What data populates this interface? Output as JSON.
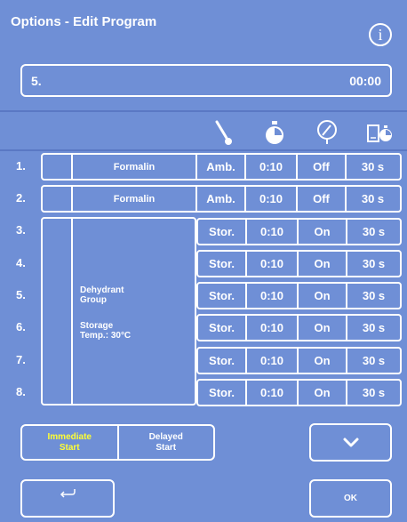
{
  "header": {
    "title": "Options - Edit Program",
    "info_icon": "info-icon"
  },
  "program": {
    "name": "5.",
    "time": "00:00"
  },
  "columns": [
    {
      "name": "temperature",
      "icon": "thermometer-icon"
    },
    {
      "name": "time",
      "icon": "stopwatch-icon"
    },
    {
      "name": "pressure-vacuum",
      "icon": "gauge-icon"
    },
    {
      "name": "drip",
      "icon": "drip-timer-icon"
    }
  ],
  "rows": [
    {
      "num": "1.",
      "reagent": "Formalin",
      "temp": "Amb.",
      "time": "0:10",
      "pv": "Off",
      "drip": "30 s"
    },
    {
      "num": "2.",
      "reagent": "Formalin",
      "temp": "Amb.",
      "time": "0:10",
      "pv": "Off",
      "drip": "30 s"
    },
    {
      "num": "3.",
      "temp": "Stor.",
      "time": "0:10",
      "pv": "On",
      "drip": "30 s"
    },
    {
      "num": "4.",
      "temp": "Stor.",
      "time": "0:10",
      "pv": "On",
      "drip": "30 s"
    },
    {
      "num": "5.",
      "temp": "Stor.",
      "time": "0:10",
      "pv": "On",
      "drip": "30 s"
    },
    {
      "num": "6.",
      "temp": "Stor.",
      "time": "0:10",
      "pv": "On",
      "drip": "30 s"
    },
    {
      "num": "7.",
      "temp": "Stor.",
      "time": "0:10",
      "pv": "On",
      "drip": "30 s"
    },
    {
      "num": "8.",
      "temp": "Stor.",
      "time": "0:10",
      "pv": "On",
      "drip": "30 s"
    }
  ],
  "group": {
    "label_line1": "Dehydrant",
    "label_line2": "Group",
    "storage_line1": "Storage",
    "storage_line2": "Temp.: 30°C"
  },
  "start_buttons": {
    "immediate_line1": "Immediate",
    "immediate_line2": "Start",
    "delayed_line1": "Delayed",
    "delayed_line2": "Start"
  },
  "buttons": {
    "ok_label": "OK",
    "down_icon": "chevron-down-icon",
    "back_icon": "return-icon"
  },
  "colors": {
    "background": "#6f8fd6",
    "border": "#ffffff",
    "selected_text": "#ffff33"
  }
}
